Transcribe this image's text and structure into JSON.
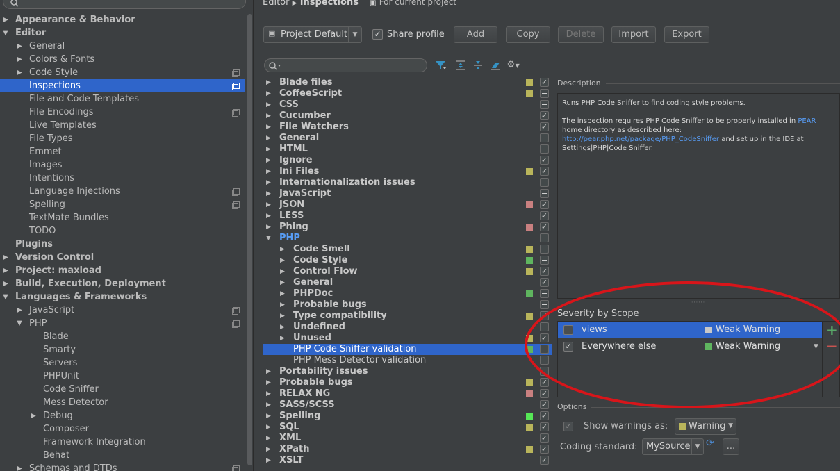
{
  "sidebar": {
    "items": [
      {
        "label": "Appearance & Behavior",
        "level": 0,
        "arrow": "closed",
        "bold": true
      },
      {
        "label": "Editor",
        "level": 0,
        "arrow": "open",
        "bold": true
      },
      {
        "label": "General",
        "level": 1,
        "arrow": "closed"
      },
      {
        "label": "Colors & Fonts",
        "level": 1,
        "arrow": "closed"
      },
      {
        "label": "Code Style",
        "level": 1,
        "arrow": "closed",
        "project": true
      },
      {
        "label": "Inspections",
        "level": 1,
        "selected": true,
        "project": true
      },
      {
        "label": "File and Code Templates",
        "level": 1
      },
      {
        "label": "File Encodings",
        "level": 1,
        "project": true
      },
      {
        "label": "Live Templates",
        "level": 1
      },
      {
        "label": "File Types",
        "level": 1
      },
      {
        "label": "Emmet",
        "level": 1
      },
      {
        "label": "Images",
        "level": 1
      },
      {
        "label": "Intentions",
        "level": 1
      },
      {
        "label": "Language Injections",
        "level": 1,
        "project": true
      },
      {
        "label": "Spelling",
        "level": 1,
        "project": true
      },
      {
        "label": "TextMate Bundles",
        "level": 1
      },
      {
        "label": "TODO",
        "level": 1
      },
      {
        "label": "Plugins",
        "level": 0,
        "bold": true
      },
      {
        "label": "Version Control",
        "level": 0,
        "arrow": "closed",
        "bold": true
      },
      {
        "label": "Project: maxload",
        "level": 0,
        "arrow": "closed",
        "bold": true
      },
      {
        "label": "Build, Execution, Deployment",
        "level": 0,
        "arrow": "closed",
        "bold": true
      },
      {
        "label": "Languages & Frameworks",
        "level": 0,
        "arrow": "open",
        "bold": true
      },
      {
        "label": "JavaScript",
        "level": 1,
        "arrow": "closed",
        "project": true
      },
      {
        "label": "PHP",
        "level": 1,
        "arrow": "open",
        "project": true
      },
      {
        "label": "Blade",
        "level": 2
      },
      {
        "label": "Smarty",
        "level": 2
      },
      {
        "label": "Servers",
        "level": 2
      },
      {
        "label": "PHPUnit",
        "level": 2
      },
      {
        "label": "Code Sniffer",
        "level": 2
      },
      {
        "label": "Mess Detector",
        "level": 2
      },
      {
        "label": "Debug",
        "level": 2,
        "arrow": "closed"
      },
      {
        "label": "Composer",
        "level": 2
      },
      {
        "label": "Framework Integration",
        "level": 2
      },
      {
        "label": "Behat",
        "level": 2
      },
      {
        "label": "Schemas and DTDs",
        "level": 1,
        "arrow": "closed",
        "project": true
      }
    ]
  },
  "header": {
    "breadcrumb_editor": "Editor",
    "breadcrumb_inspections": "Inspections",
    "scope_note": "For current project"
  },
  "toolbar": {
    "profile": "Project Default",
    "share_profile": "Share profile",
    "add": "Add",
    "copy": "Copy",
    "delete": "Delete",
    "import": "Import",
    "export": "Export"
  },
  "colors": {
    "typo": "#b9b55b",
    "weak": "#5fb55f",
    "error": "#c98080",
    "green_bright": "#56e756",
    "selection": "#2f65ca",
    "link": "#589df6"
  },
  "inspections": {
    "rows": [
      {
        "label": "Blade files",
        "level": 0,
        "arrow": "closed",
        "sev": "typo",
        "check": "on"
      },
      {
        "label": "CoffeeScript",
        "level": 0,
        "arrow": "closed",
        "sev": "typo",
        "check": "dash"
      },
      {
        "label": "CSS",
        "level": 0,
        "arrow": "closed",
        "check": "dash"
      },
      {
        "label": "Cucumber",
        "level": 0,
        "arrow": "closed",
        "check": "on"
      },
      {
        "label": "File Watchers",
        "level": 0,
        "arrow": "closed",
        "check": "on"
      },
      {
        "label": "General",
        "level": 0,
        "arrow": "closed",
        "check": "dash"
      },
      {
        "label": "HTML",
        "level": 0,
        "arrow": "closed",
        "check": "dash"
      },
      {
        "label": "Ignore",
        "level": 0,
        "arrow": "closed",
        "check": "on"
      },
      {
        "label": "Ini Files",
        "level": 0,
        "arrow": "closed",
        "sev": "typo",
        "check": "on"
      },
      {
        "label": "Internationalization issues",
        "level": 0,
        "arrow": "closed",
        "check": "off"
      },
      {
        "label": "JavaScript",
        "level": 0,
        "arrow": "closed",
        "check": "dash"
      },
      {
        "label": "JSON",
        "level": 0,
        "arrow": "closed",
        "sev": "error",
        "check": "on"
      },
      {
        "label": "LESS",
        "level": 0,
        "arrow": "closed",
        "check": "on"
      },
      {
        "label": "Phing",
        "level": 0,
        "arrow": "closed",
        "sev": "error",
        "check": "on"
      },
      {
        "label": "PHP",
        "level": 0,
        "arrow": "open",
        "php": true,
        "check": "dash"
      },
      {
        "label": "Code Smell",
        "level": 1,
        "arrow": "closed",
        "sev": "typo",
        "check": "dash"
      },
      {
        "label": "Code Style",
        "level": 1,
        "arrow": "closed",
        "sev": "weak",
        "check": "dash"
      },
      {
        "label": "Control Flow",
        "level": 1,
        "arrow": "closed",
        "sev": "typo",
        "check": "on"
      },
      {
        "label": "General",
        "level": 1,
        "arrow": "closed",
        "check": "on"
      },
      {
        "label": "PHPDoc",
        "level": 1,
        "arrow": "closed",
        "sev": "weak",
        "check": "dash"
      },
      {
        "label": "Probable bugs",
        "level": 1,
        "arrow": "closed",
        "check": "dash"
      },
      {
        "label": "Type compatibility",
        "level": 1,
        "arrow": "closed",
        "sev": "typo",
        "check": "on"
      },
      {
        "label": "Undefined",
        "level": 1,
        "arrow": "closed",
        "check": "dash"
      },
      {
        "label": "Unused",
        "level": 1,
        "arrow": "closed",
        "sev": "typo",
        "check": "on"
      },
      {
        "label": "PHP Code Sniffer validation",
        "level": 1,
        "plain": true,
        "selected": true,
        "sev": "weak",
        "check": "dash"
      },
      {
        "label": "PHP Mess Detector validation",
        "level": 1,
        "plain": true,
        "check": "off"
      },
      {
        "label": "Portability issues",
        "level": 0,
        "arrow": "closed",
        "check": "off"
      },
      {
        "label": "Probable bugs",
        "level": 0,
        "arrow": "closed",
        "sev": "typo",
        "check": "on"
      },
      {
        "label": "RELAX NG",
        "level": 0,
        "arrow": "closed",
        "sev": "error",
        "check": "on"
      },
      {
        "label": "SASS/SCSS",
        "level": 0,
        "arrow": "closed",
        "check": "on"
      },
      {
        "label": "Spelling",
        "level": 0,
        "arrow": "closed",
        "sev": "green_bright",
        "check": "on"
      },
      {
        "label": "SQL",
        "level": 0,
        "arrow": "closed",
        "sev": "typo",
        "check": "on"
      },
      {
        "label": "XML",
        "level": 0,
        "arrow": "closed",
        "check": "on"
      },
      {
        "label": "XPath",
        "level": 0,
        "arrow": "closed",
        "sev": "typo",
        "check": "on"
      },
      {
        "label": "XSLT",
        "level": 0,
        "arrow": "closed",
        "check": "on"
      }
    ]
  },
  "description": {
    "heading": "Description",
    "line1": "Runs PHP Code Sniffer to find coding style problems.",
    "line2a": "The inspection requires PHP Code Sniffer to be properly installed in ",
    "link_pear": "PEAR",
    "line2b": " home directory as described here: ",
    "link_url": "http://pear.php.net/package/PHP_CodeSniffer",
    "line2c": " and set up in the IDE at Settings|PHP|Code Sniffer."
  },
  "severity_scope": {
    "heading": "Severity by Scope",
    "rows": [
      {
        "scope": "views",
        "severity": "Weak Warning",
        "checked": false,
        "selected": true,
        "swatch": "#c8c8c8"
      },
      {
        "scope": "Everywhere else",
        "severity": "Weak Warning",
        "checked": true,
        "swatch": "#5fb55f"
      }
    ],
    "add_icon": "+",
    "remove_icon": "−"
  },
  "options": {
    "heading": "Options",
    "show_warnings_label": "Show warnings as:",
    "show_warnings_value": "Warning",
    "coding_standard_label": "Coding standard:",
    "coding_standard_value": "MySource",
    "browse": "..."
  }
}
